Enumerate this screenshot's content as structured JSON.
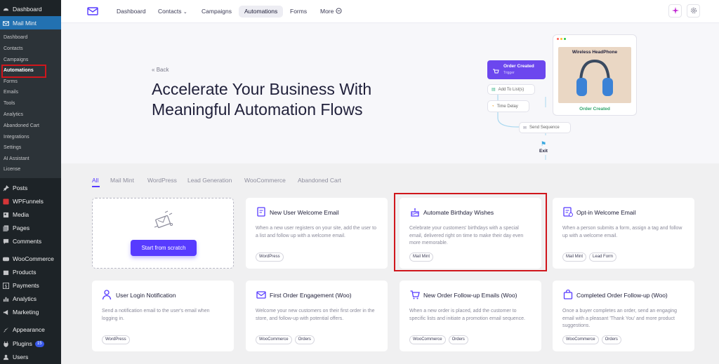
{
  "sidebar": {
    "top": [
      {
        "label": "Dashboard",
        "icon": "dashboard-icon"
      },
      {
        "label": "Mail Mint",
        "icon": "mail-icon"
      }
    ],
    "submenu": [
      "Dashboard",
      "Contacts",
      "Campaigns",
      "Automations",
      "Forms",
      "Emails",
      "Tools",
      "Analytics",
      "Abandoned Cart",
      "Integrations",
      "Settings",
      "AI Assistant",
      "License"
    ],
    "bottom": [
      {
        "label": "Posts",
        "icon": "pin-icon"
      },
      {
        "label": "WPFunnels",
        "icon": "funnel-icon"
      },
      {
        "label": "Media",
        "icon": "media-icon"
      },
      {
        "label": "Pages",
        "icon": "pages-icon"
      },
      {
        "label": "Comments",
        "icon": "comment-icon"
      },
      {
        "label": "WooCommerce",
        "icon": "woo-icon"
      },
      {
        "label": "Products",
        "icon": "box-icon"
      },
      {
        "label": "Payments",
        "icon": "dollar-icon"
      },
      {
        "label": "Analytics",
        "icon": "chart-icon"
      },
      {
        "label": "Marketing",
        "icon": "megaphone-icon"
      },
      {
        "label": "Appearance",
        "icon": "brush-icon"
      },
      {
        "label": "Plugins",
        "icon": "plug-icon",
        "badge": "15"
      },
      {
        "label": "Users",
        "icon": "user-icon"
      }
    ]
  },
  "topnav": {
    "items": [
      "Dashboard",
      "Contacts",
      "Campaigns",
      "Automations",
      "Forms",
      "More"
    ],
    "active": "Automations"
  },
  "hero": {
    "back": "Back",
    "headline": "Accelerate Your Business With Meaningful Automation Flows",
    "flow": {
      "trigger_title": "Order Created",
      "trigger_sub": "Trigger",
      "add_to_list": "Add To List(s)",
      "time_delay": "Time Delay",
      "send_sequence": "Send Sequence",
      "exit": "Exit",
      "product_name": "Wireless HeadPhone",
      "product_caption": "Order Created"
    }
  },
  "filters": [
    "All",
    "Mail Mint",
    "WordPress",
    "Lead Generation",
    "WooCommerce",
    "Abandoned Cart"
  ],
  "scratch": {
    "button": "Start from scratch"
  },
  "cards": [
    {
      "title": "New User Welcome Email",
      "desc": "When a new user registers on your site, add the user to a list and follow up with a welcome email.",
      "tags": [
        "WordPress"
      ],
      "icon": "document-icon"
    },
    {
      "title": "Automate Birthday Wishes",
      "desc": "Celebrate your customers' birthdays with a special email, delivered right on time to make their day even more memorable.",
      "tags": [
        "Mail Mint"
      ],
      "icon": "cake-icon"
    },
    {
      "title": "Opt-in Welcome Email",
      "desc": "When a person submits a form, assign a tag and follow up with a welcome email.",
      "tags": [
        "Mail Mint",
        "Lead Form"
      ],
      "icon": "form-icon"
    },
    {
      "title": "User Login Notification",
      "desc": "Send a notification email to the user's email when logging in.",
      "tags": [
        "WordPress"
      ],
      "icon": "user-login-icon"
    },
    {
      "title": "First Order Engagement (Woo)",
      "desc": "Welcome your new customers on their first order in the store, and follow-up with potential offers.",
      "tags": [
        "WooCommerce",
        "Orders"
      ],
      "icon": "envelope-icon"
    },
    {
      "title": "New Order Follow-up Emails (Woo)",
      "desc": "When a new order is placed, add the customer to specific lists and initiate a promotion email sequence.",
      "tags": [
        "WooCommerce",
        "Orders"
      ],
      "icon": "cart-icon"
    },
    {
      "title": "Completed Order Follow-up (Woo)",
      "desc": "Once a buyer completes an order, send an engaging email with a pleasant 'Thank You' and more product suggestions.",
      "tags": [
        "WooCommerce",
        "Orders"
      ],
      "icon": "bag-icon"
    }
  ],
  "colors": {
    "accent": "#573bff",
    "sidebar": "#1d2327",
    "highlight": "#d0161c"
  }
}
